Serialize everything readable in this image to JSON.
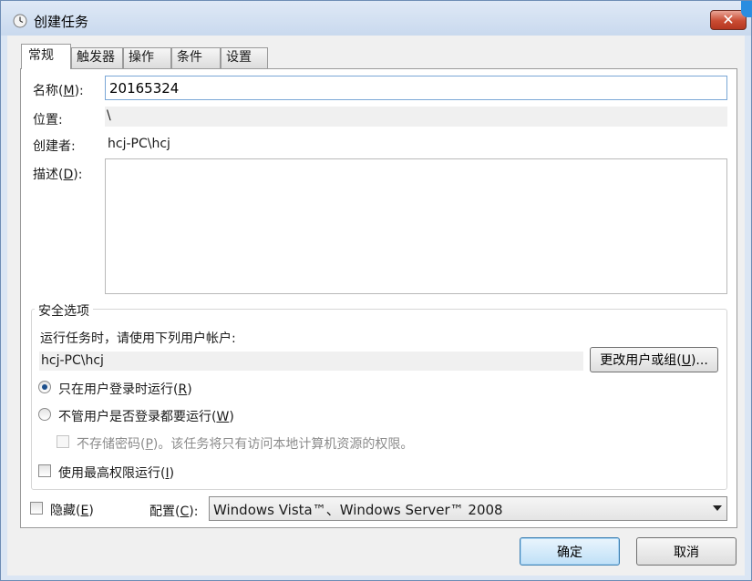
{
  "window": {
    "title": "创建任务",
    "close_label": "✕"
  },
  "tabs": [
    {
      "label": "常规"
    },
    {
      "label": "触发器"
    },
    {
      "label": "操作"
    },
    {
      "label": "条件"
    },
    {
      "label": "设置"
    }
  ],
  "general": {
    "name_label": "名称(",
    "name_key": "M",
    "name_label_end": "):",
    "name_value": "20165324",
    "location_label": "位置:",
    "location_value": "\\",
    "author_label": "创建者:",
    "author_value": "hcj-PC\\hcj",
    "description_label": "描述(",
    "description_key": "D",
    "description_label_end": "):",
    "description_value": ""
  },
  "security": {
    "legend": "安全选项",
    "run_as_prompt": "运行任务时，请使用下列用户帐户:",
    "user_account": "hcj-PC\\hcj",
    "change_user_button": "更改用户或组(",
    "change_user_key": "U",
    "change_user_end": ")...",
    "radio_logged_on": "只在用户登录时运行(",
    "radio_logged_on_key": "R",
    "radio_logged_on_end": ")",
    "radio_logged_on_selected": true,
    "radio_any": "不管用户是否登录都要运行(",
    "radio_any_key": "W",
    "radio_any_end": ")",
    "no_store_pw": "不存储密码(",
    "no_store_pw_key": "P",
    "no_store_pw_end": ")。该任务将只有访问本地计算机资源的权限。",
    "highest_priv": "使用最高权限运行(",
    "highest_priv_key": "I",
    "highest_priv_end": ")"
  },
  "footer": {
    "hidden_label": "隐藏(",
    "hidden_key": "E",
    "hidden_end": ")",
    "config_label": "配置(",
    "config_key": "C",
    "config_end": "):",
    "config_value": "Windows Vista™、Windows Server™ 2008"
  },
  "buttons": {
    "ok": "确定",
    "cancel": "取消"
  }
}
